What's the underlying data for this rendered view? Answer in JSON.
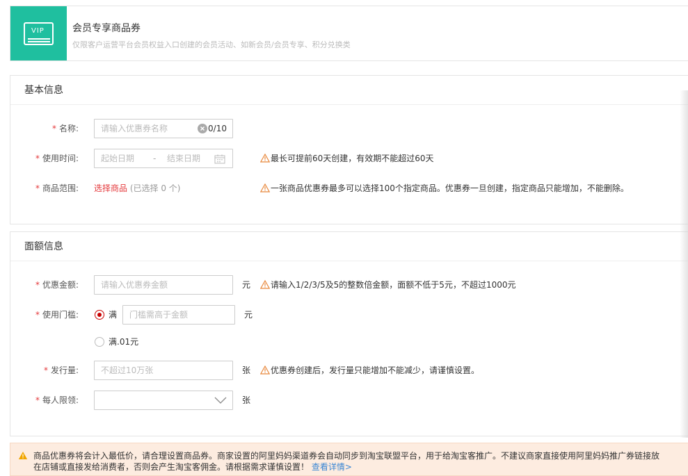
{
  "header": {
    "vip_badge": "VIP",
    "title": "会员专享商品券",
    "subtitle": "仅限客户运营平台会员权益入口创建的会员活动、如新会员/会员专享、积分兑换类",
    "accent_color": "#1fbf9f"
  },
  "basic": {
    "section_title": "基本信息",
    "name": {
      "label": "名称:",
      "placeholder": "请输入优惠券名称",
      "counter": "0/10"
    },
    "time": {
      "label": "使用时间:",
      "start_placeholder": "起始日期",
      "separator": "-",
      "end_placeholder": "结束日期",
      "tip": "最长可提前60天创建，有效期不能超过60天"
    },
    "scope": {
      "label": "商品范围:",
      "link": "选择商品",
      "selected": "(已选择 0 个)",
      "tip": "一张商品优惠券最多可以选择100个指定商品。优惠券一旦创建，指定商品只能增加，不能删除。"
    }
  },
  "amount": {
    "section_title": "面额信息",
    "discount": {
      "label": "优惠金额:",
      "placeholder": "请输入优惠券金额",
      "unit": "元",
      "tip": "请输入1/2/3/5及5的整数倍金额，面额不低于5元，不超过1000元"
    },
    "threshold": {
      "label": "使用门槛:",
      "option1": "满",
      "placeholder": "门槛需高于金额",
      "unit": "元",
      "option2": "满.01元"
    },
    "quantity": {
      "label": "发行量:",
      "placeholder": "不超过10万张",
      "unit": "张",
      "tip": "优惠券创建后，发行量只能增加不能减少，请谨慎设置。"
    },
    "limit": {
      "label": "每人限领:",
      "value": "",
      "unit": "张"
    }
  },
  "notice": {
    "text_line1": "商品优惠券将会计入最低价，请合理设置商品券。商家设置的阿里妈妈渠道券会自动同步到淘宝联盟平台，用于给淘宝客推广。不建议商家直接使用阿里妈妈推广券链接放",
    "text_line2": "在店铺或直接发给消费者，否则会产生淘宝客佣金。请根据需求谨慎设置！",
    "link": "查看详情>"
  },
  "colors": {
    "required": "#e4393c",
    "warning": "#e8873a",
    "link": "#3a86d4",
    "radio": "#c80000"
  }
}
